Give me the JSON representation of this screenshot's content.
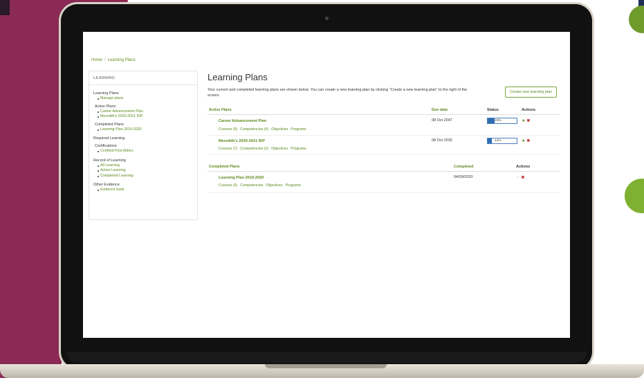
{
  "breadcrumb": [
    "Home",
    "Learning Plans"
  ],
  "sidebar": {
    "heading": "LEARNING",
    "learning_plans": "Learning Plans",
    "manage_plans": "Manage plans",
    "active_plans": "Active Plans",
    "active_items": [
      "Career Advancement Plan",
      "Meredith's 2020-2021 IDP"
    ],
    "completed_plans": "Completed Plans",
    "completed_items": [
      "Learning Plan 2019-2020"
    ],
    "required_learning": "Required Learning",
    "certifications": "Certifications",
    "cert_items": [
      "Certified First Aiders"
    ],
    "record_of_learning": "Record of Learning",
    "record_items": [
      "All Learning",
      "Active Learning",
      "Completed Learning"
    ],
    "other_evidence": "Other Evidence",
    "evidence_items": [
      "Evidence bank"
    ]
  },
  "main": {
    "title": "Learning Plans",
    "intro": "Your current and completed learning plans are shown below. You can create a new learning plan by clicking \"Create a new learning plan\" to the right of the screen.",
    "create_button": "Create new learning plan"
  },
  "active_table": {
    "headers": {
      "name": "Active Plans",
      "due": "Due date",
      "status": "Status",
      "actions": "Actions"
    },
    "rows": [
      {
        "name": "Career Advancement Plan",
        "links": [
          "Courses (9)",
          "Competencies (4)",
          "Objectives",
          "Programs"
        ],
        "due": "08 Oct 2047",
        "progress_label": "23%",
        "progress": 23
      },
      {
        "name": "Meredith's 2020-2021 IDP",
        "links": [
          "Courses (7)",
          "Competencies (2)",
          "Objectives",
          "Programs"
        ],
        "due": "08 Oct 2032",
        "progress_label": "14%",
        "progress": 14
      }
    ]
  },
  "completed_table": {
    "headers": {
      "name": "Completed Plans",
      "completed": "Completed",
      "actions": "Actions"
    },
    "rows": [
      {
        "name": "Learning Plan 2019-2020",
        "links": [
          "Courses (5)",
          "Competencies",
          "Objectives",
          "Programs"
        ],
        "completed": "04/09/2020"
      }
    ]
  },
  "colors": {
    "accent_green": "#5c8a1c",
    "progress_blue": "#2f6db3",
    "brand_magenta": "#8a2a55",
    "delete_red": "#c03030"
  },
  "icons": {
    "active_action_star": "star-icon",
    "completed_action_star": "star-outline-icon",
    "delete": "close-icon"
  }
}
